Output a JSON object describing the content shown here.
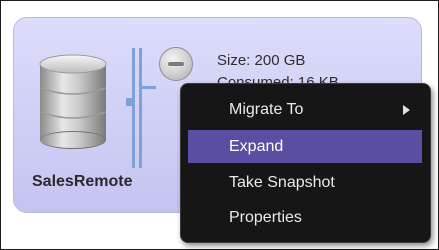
{
  "volume": {
    "name": "SalesRemote",
    "size": "Size: 200 GB",
    "consumed": "Consumed: 16 KB",
    "icon": "database-disk-icon",
    "collapse_icon": "minus-circle-icon"
  },
  "context_menu": {
    "items": [
      {
        "label": "Migrate To",
        "has_submenu": true
      },
      {
        "label": "Expand",
        "highlighted": true
      },
      {
        "label": "Take Snapshot"
      },
      {
        "label": "Properties"
      }
    ],
    "highlight_color": "#5a4ea3",
    "background_color": "#161616"
  },
  "colors": {
    "card_background": "#d3d3f8",
    "card_border": "#b9b7e6"
  }
}
